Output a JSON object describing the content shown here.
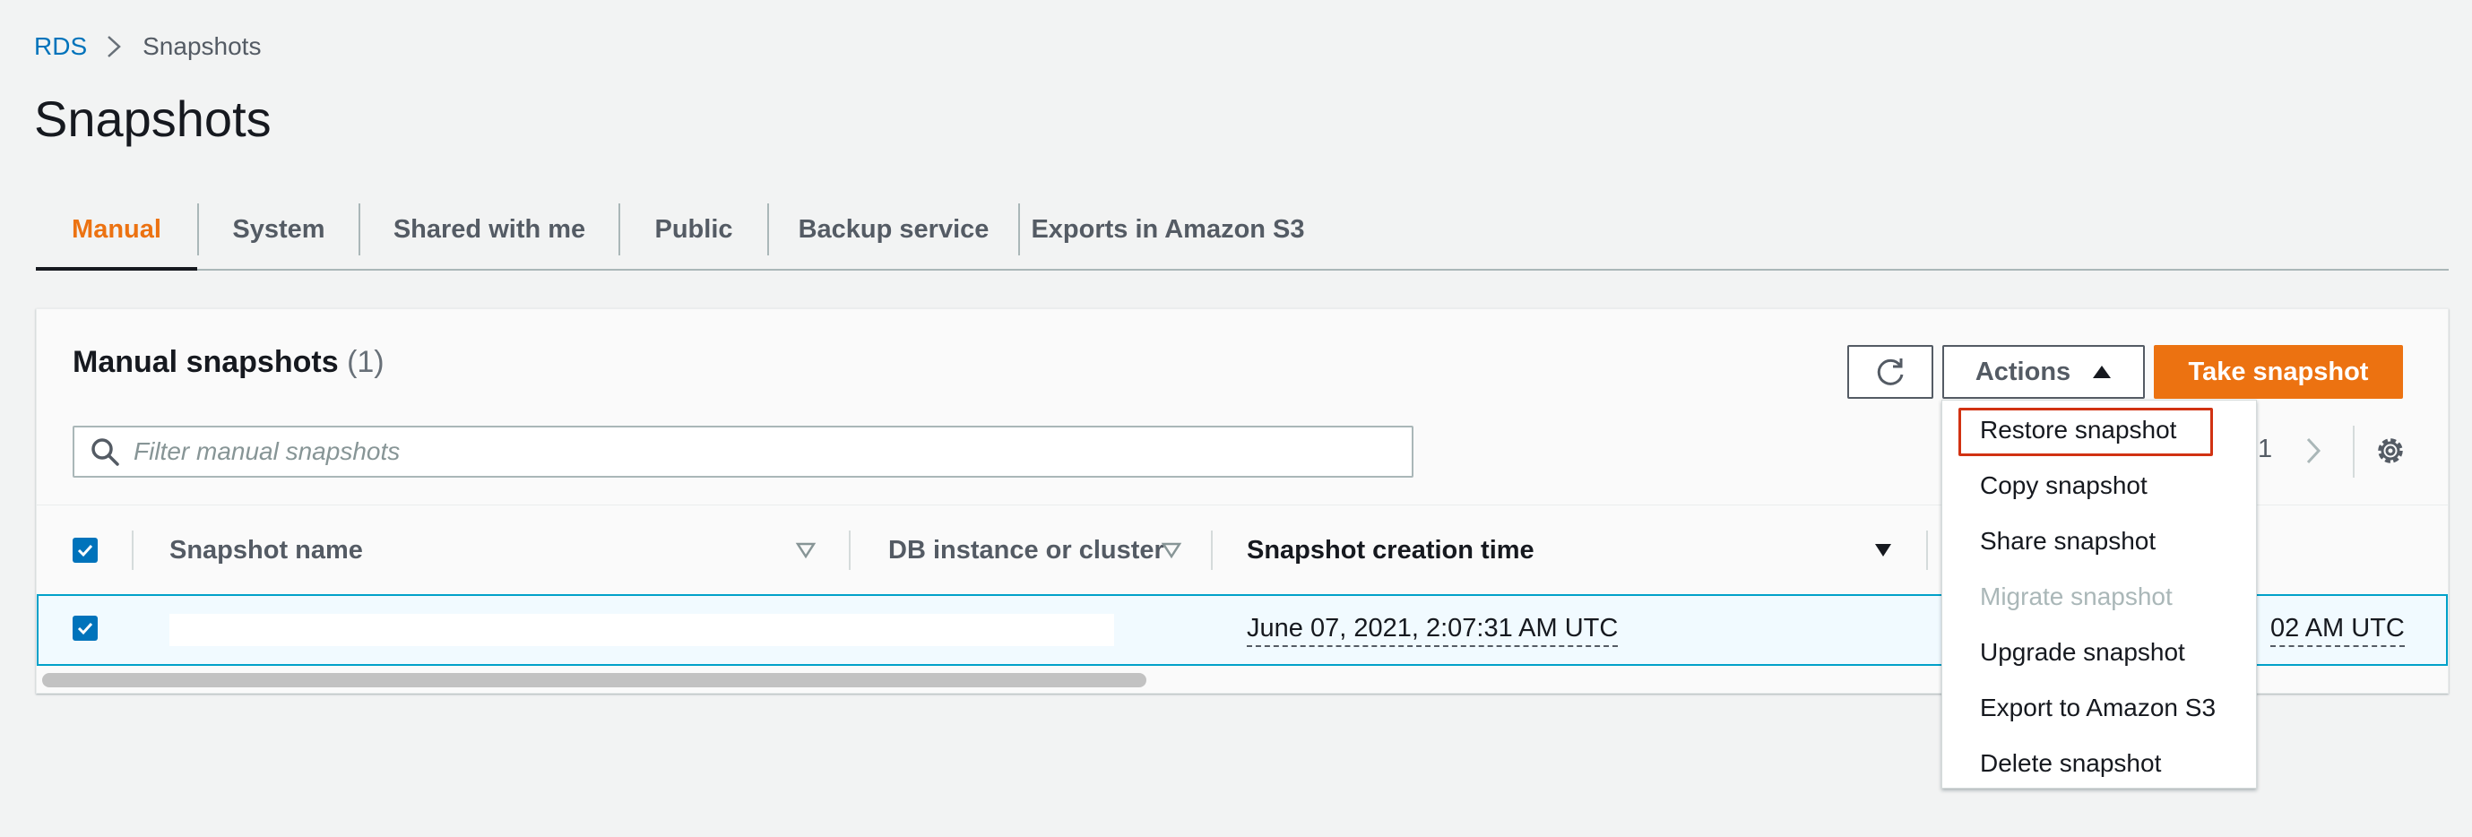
{
  "breadcrumb": {
    "root": "RDS",
    "current": "Snapshots"
  },
  "page_title": "Snapshots",
  "tabs": [
    {
      "label": "Manual",
      "active": true
    },
    {
      "label": "System"
    },
    {
      "label": "Shared with me"
    },
    {
      "label": "Public"
    },
    {
      "label": "Backup service"
    },
    {
      "label": "Exports in Amazon S3"
    }
  ],
  "panel": {
    "title": "Manual snapshots",
    "count": "(1)",
    "actions_label": "Actions",
    "take_snapshot_label": "Take snapshot",
    "search_placeholder": "Filter manual snapshots",
    "page_number": "1"
  },
  "table": {
    "columns": [
      "Snapshot name",
      "DB instance or cluster",
      "Snapshot creation time"
    ],
    "rows": [
      {
        "snapshot_name": "",
        "creation_time": "June 07, 2021, 2:07:31 AM UTC",
        "partial_time": "02 AM UTC"
      }
    ]
  },
  "actions_menu": [
    {
      "label": "Restore snapshot",
      "highlight": true
    },
    {
      "label": "Copy snapshot"
    },
    {
      "label": "Share snapshot"
    },
    {
      "label": "Migrate snapshot",
      "disabled": true
    },
    {
      "label": "Upgrade snapshot"
    },
    {
      "label": "Export to Amazon S3"
    },
    {
      "label": "Delete snapshot"
    }
  ],
  "colors": {
    "accent": "#ec7211",
    "link": "#0073bb",
    "highlight_border": "#d13212"
  },
  "icons": {
    "refresh": "refresh-icon",
    "actions_caret": "caret-up-icon",
    "search": "search-icon",
    "next": "chevron-right-icon",
    "settings": "gear-icon",
    "sort": "sort-triangle-icon",
    "checkbox": "checkbox-checked-icon"
  }
}
